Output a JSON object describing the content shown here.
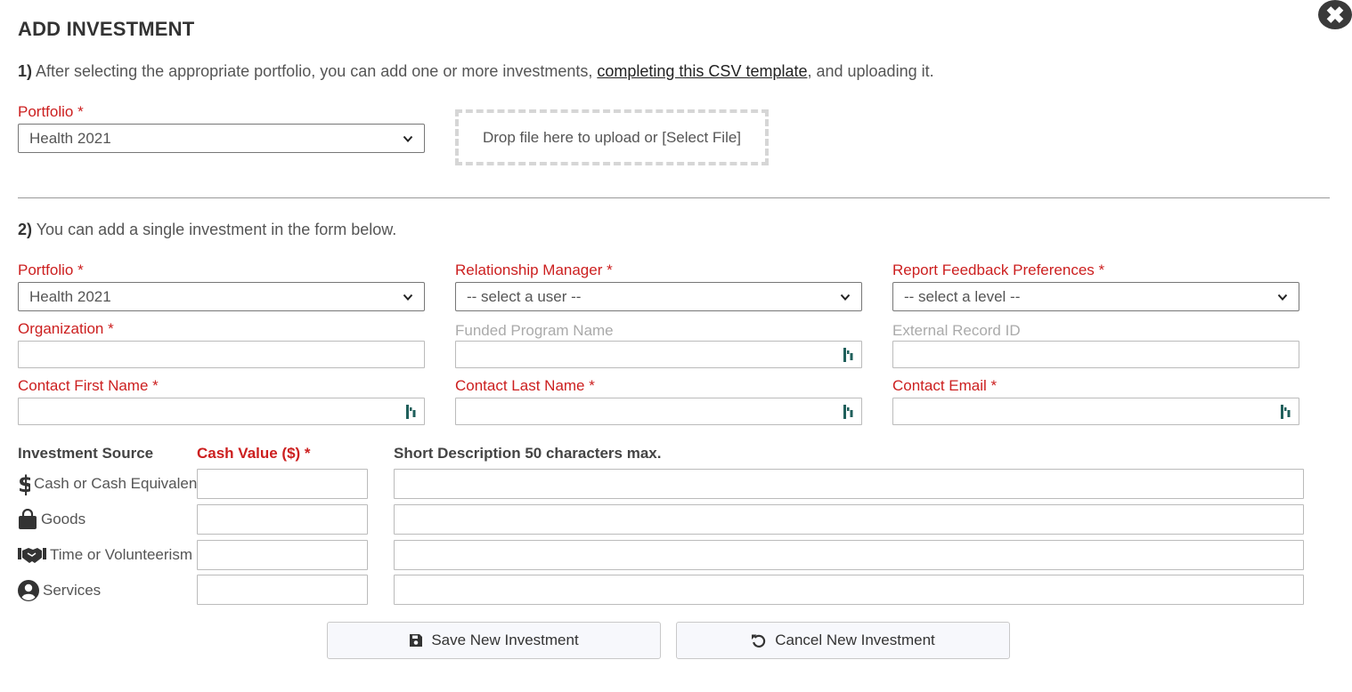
{
  "modal": {
    "title": "ADD INVESTMENT",
    "close_label": "✖"
  },
  "step1": {
    "number": "1)",
    "text_before": " After selecting the appropriate portfolio, you can add one or more investments, ",
    "link": "completing this CSV template",
    "text_after": ", and uploading it.",
    "portfolio_label": "Portfolio *",
    "portfolio_value": "Health 2021",
    "dropzone_text": "Drop file here to upload or [Select File]"
  },
  "step2": {
    "number": "2)",
    "text": " You can add a single investment in the form below.",
    "portfolio_label": "Portfolio *",
    "portfolio_value": "Health 2021",
    "rm_label": "Relationship Manager *",
    "rm_value": "-- select a user --",
    "rfp_label": "Report Feedback Preferences *",
    "rfp_value": "-- select a level --",
    "org_label": "Organization *",
    "fpn_label": "Funded Program Name",
    "ext_label": "External Record ID",
    "cfn_label": "Contact First Name *",
    "cln_label": "Contact Last Name *",
    "ce_label": "Contact Email *"
  },
  "sources": {
    "col_source": "Investment Source",
    "col_cash": "Cash Value ($) *",
    "col_desc": "Short Description 50 characters max.",
    "rows": [
      {
        "label": "Cash or Cash Equivalent",
        "icon": "dollar-icon"
      },
      {
        "label": "Goods",
        "icon": "shopping-bag-icon"
      },
      {
        "label": "Time or Volunteerism",
        "icon": "handshake-icon"
      },
      {
        "label": "Services",
        "icon": "user-circle-icon"
      }
    ]
  },
  "actions": {
    "save_label": "Save New Investment",
    "cancel_label": "Cancel New Investment"
  },
  "colors": {
    "required": "#cc1f1f",
    "accent_icon": "#1f5f5b"
  }
}
